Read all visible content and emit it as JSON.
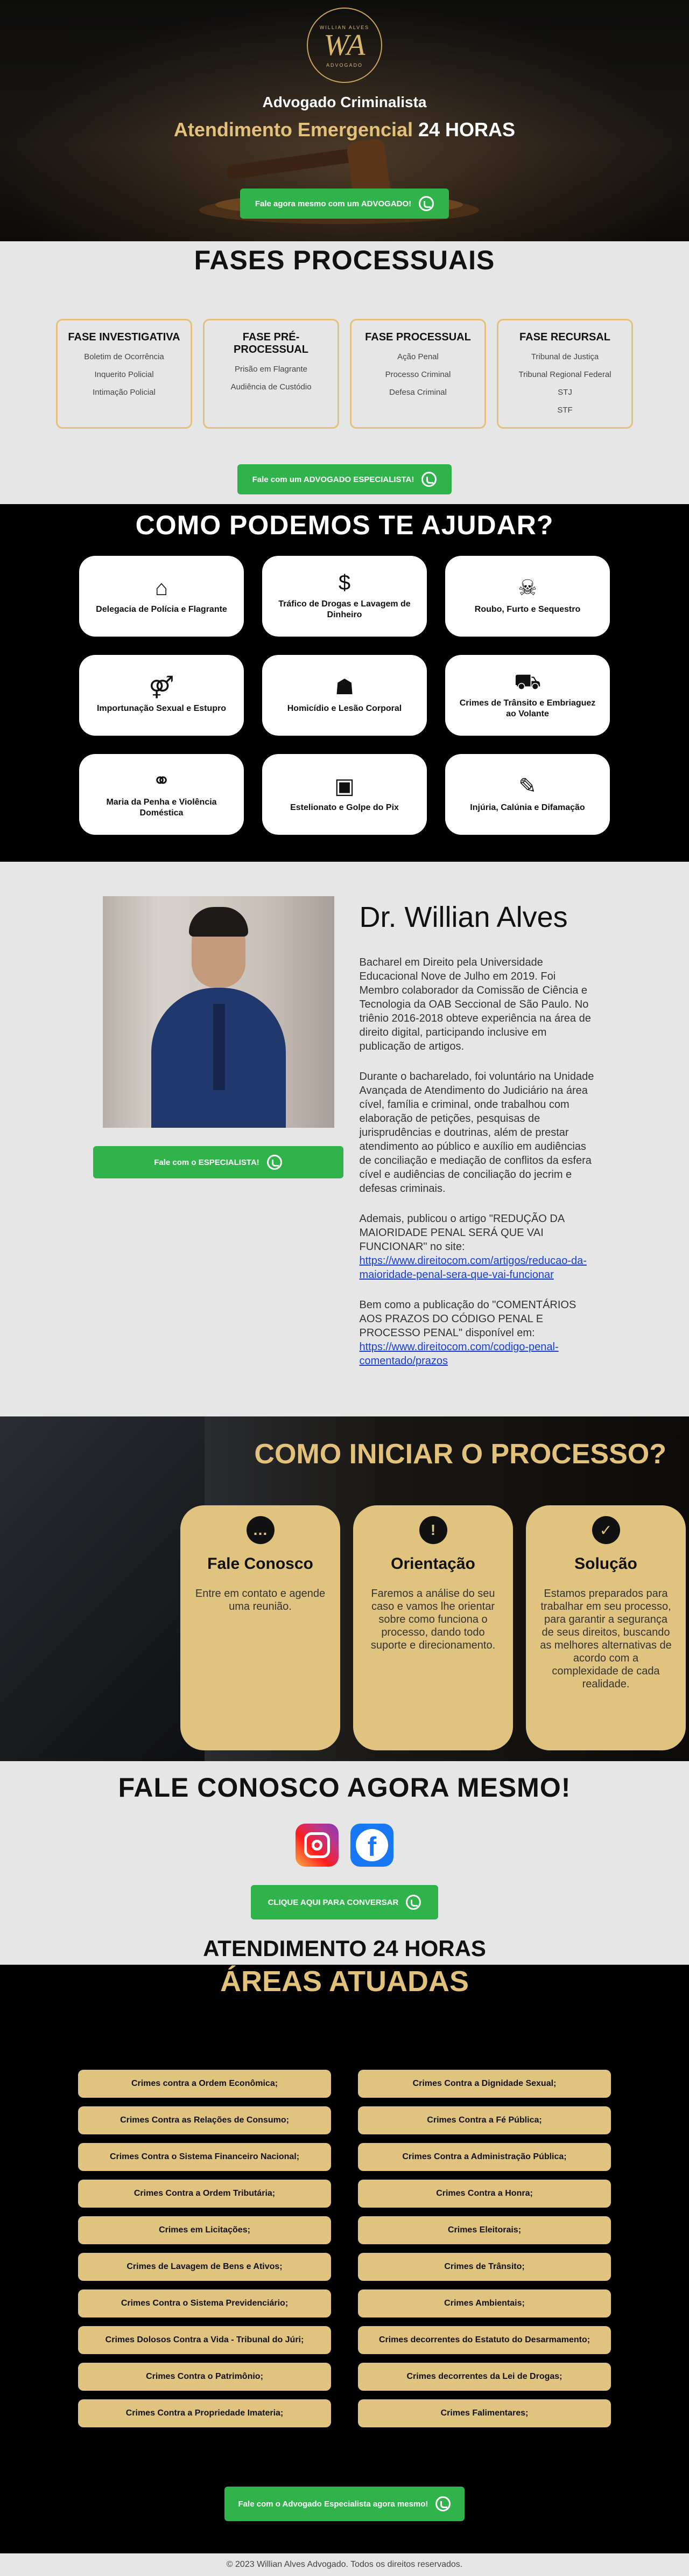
{
  "hero": {
    "logo_monogram": "WA",
    "logo_top": "WILLIAN ALVES",
    "logo_bottom": "ADVOGADO",
    "subtitle": "Advogado Criminalista",
    "headline_gold": "Atendimento Emergencial",
    "headline_white": "24 HORAS",
    "cta": "Fale agora mesmo com um ADVOGADO!"
  },
  "phases": {
    "title": "FASES PROCESSUAIS",
    "items": [
      {
        "title": "FASE INVESTIGATIVA",
        "lines": [
          "Boletim de Ocorrência",
          "Inquerito Policial",
          "Intimação Policial"
        ]
      },
      {
        "title": "FASE PRÉ-PROCESSUAL",
        "lines": [
          "Prisão em Flagrante",
          "Audiência de Custódio"
        ]
      },
      {
        "title": "FASE PROCESSUAL",
        "lines": [
          "Ação Penal",
          "Processo Criminal",
          "Defesa Criminal"
        ]
      },
      {
        "title": "FASE RECURSAL",
        "lines": [
          "Tribunal de Justiça",
          "Tribunal Regional Federal",
          "STJ",
          "STF"
        ]
      }
    ],
    "cta": "Fale com um ADVOGADO ESPECIALISTA!"
  },
  "help": {
    "title": "COMO PODEMOS TE AJUDAR?",
    "items": [
      {
        "icon": "police-station-icon",
        "glyph": "⌂",
        "label": "Delegacia de Polícia e Flagrante"
      },
      {
        "icon": "money-bag-icon",
        "glyph": "$",
        "label": "Tráfico de Drogas e Lavagem de Dinheiro"
      },
      {
        "icon": "thief-icon",
        "glyph": "☠",
        "label": "Roubo, Furto e Sequestro"
      },
      {
        "icon": "people-icon",
        "glyph": "⚤",
        "label": "Importunação Sexual e Estupro"
      },
      {
        "icon": "person-icon",
        "glyph": "☗",
        "label": "Homicídio e Lesão Corporal"
      },
      {
        "icon": "car-icon",
        "glyph": "⛟",
        "label": "Crimes de Trânsito e Embriaguez ao Volante"
      },
      {
        "icon": "family-icon",
        "glyph": "⚭",
        "label": "Maria da Penha e Violência Doméstica"
      },
      {
        "icon": "banknote-icon",
        "glyph": "▣",
        "label": "Estelionato e Golpe do Pix"
      },
      {
        "icon": "speech-bubble-icon",
        "glyph": "✎",
        "label": "Injúria, Calúnia e Difamação"
      }
    ]
  },
  "about": {
    "name": "Dr. Willian Alves",
    "cta": "Fale com o ESPECIALISTA!",
    "p1": "Bacharel em Direito pela Universidade Educacional Nove de Julho em 2019. Foi Membro colaborador da Comissão de Ciência e Tecnologia da OAB Seccional de São Paulo. No triênio 2016-2018 obteve experiência na área de direito digital, participando inclusive em publicação de artigos.",
    "p2": "Durante o bacharelado, foi voluntário na Unidade Avançada de Atendimento do Judiciário na área cível, família e criminal, onde trabalhou com elaboração de petições, pesquisas de jurisprudências e doutrinas, além de prestar atendimento ao público e auxílio em audiências de conciliação e mediação de conflitos da esfera cível e audiências de conciliação do jecrim e defesas criminais.",
    "p3_text": "Ademais, publicou o artigo \"REDUÇÃO DA MAIORIDADE PENAL SERÁ QUE VAI FUNCIONAR\" no site:",
    "p3_link": "https://www.direitocom.com/artigos/reducao-da-maioridade-penal-sera-que-vai-funcionar",
    "p4_text": "Bem como a publicação do \"COMENTÁRIOS AOS PRAZOS DO CÓDIGO PENAL E PROCESSO PENAL\" disponível em:",
    "p4_link": "https://www.direitocom.com/codigo-penal-comentado/prazos"
  },
  "process": {
    "title": "COMO INICIAR O PROCESSO?",
    "steps": [
      {
        "icon": "chat-icon",
        "glyph": "…",
        "title": "Fale Conosco",
        "text": "Entre em contato e agende uma reunião."
      },
      {
        "icon": "alert-icon",
        "glyph": "!",
        "title": "Orientação",
        "text": "Faremos a análise do seu caso e vamos lhe orientar sobre como funciona o processo, dando todo suporte e direcionamento."
      },
      {
        "icon": "check-icon",
        "glyph": "✓",
        "title": "Solução",
        "text": "Estamos preparados para trabalhar em seu processo, para garantir a segurança de seus direitos, buscando as melhores alternativas de acordo com a complexidade de cada realidade."
      }
    ]
  },
  "contact": {
    "title": "FALE CONOSCO AGORA MESMO!",
    "cta": "CLIQUE AQUI PARA CONVERSAR",
    "subtitle": "ATENDIMENTO 24 HORAS",
    "facebook_glyph": "f"
  },
  "areas": {
    "title": "ÁREAS ATUADAS",
    "items": [
      "Crimes contra a Ordem Econômica;",
      "Crimes Contra a Dignidade Sexual;",
      "Crimes Contra as Relações de Consumo;",
      "Crimes Contra a Fé Pública;",
      "Crimes Contra o Sistema Financeiro Nacional;",
      "Crimes Contra a Administração Pública;",
      "Crimes Contra a Ordem Tributária;",
      "Crimes Contra a Honra;",
      "Crimes em Licitações;",
      "Crimes Eleitorais;",
      "Crimes de Lavagem de Bens e Ativos;",
      "Crimes de Trânsito;",
      "Crimes Contra o Sistema Previdenciário;",
      "Crimes Ambientais;",
      "Crimes Dolosos Contra a Vida - Tribunal do Júri;",
      "Crimes decorrentes do Estatuto do Desarmamento;",
      "Crimes Contra o Patrimônio;",
      "Crimes decorrentes da Lei de Drogas;",
      "Crimes Contra a Propriedade Imateria;",
      "Crimes Falimentares;"
    ],
    "cta": "Fale com o Advogado Especialista agora mesmo!"
  },
  "footer": {
    "text": "© 2023 Willian Alves Advogado. Todos os direitos reservados."
  },
  "colors": {
    "gold": "#e2c27a",
    "whatsapp_green": "#2fb34a",
    "dark": "#000000"
  }
}
